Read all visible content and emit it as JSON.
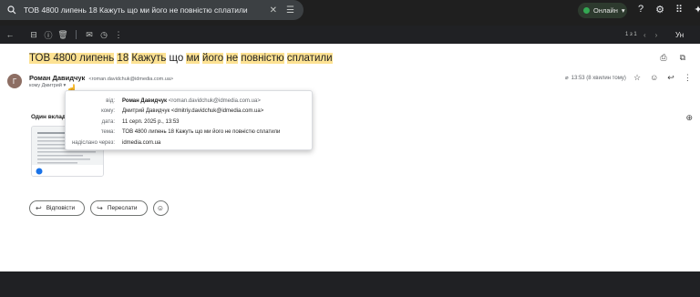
{
  "search": {
    "query": "ТОВ  4800 липень 18 Кажуть що ми його не повністю сплатили"
  },
  "status": {
    "label": "Онлайн"
  },
  "toolbar": {
    "count": "1 з 1",
    "lang": "Ун"
  },
  "email": {
    "subject_parts": [
      {
        "text": "ТОВ 4800 ",
        "hl": true
      },
      {
        "text": "липень",
        "hl": true
      },
      {
        "text": " ",
        "hl": false
      },
      {
        "text": "18",
        "hl": true
      },
      {
        "text": " ",
        "hl": false
      },
      {
        "text": "Кажуть",
        "hl": true
      },
      {
        "text": " що ",
        "hl": false
      },
      {
        "text": "ми",
        "hl": true
      },
      {
        "text": " ",
        "hl": false
      },
      {
        "text": "його",
        "hl": true
      },
      {
        "text": " ",
        "hl": false
      },
      {
        "text": "не",
        "hl": true
      },
      {
        "text": " ",
        "hl": false
      },
      {
        "text": "повністю",
        "hl": true
      },
      {
        "text": " ",
        "hl": false
      },
      {
        "text": "сплатили",
        "hl": true
      }
    ],
    "avatar_letter": "Г",
    "sender_name": "Роман Давидчук",
    "sender_email": "<roman.davidchuk@idmedia.com.ua>",
    "to_line": "кому Дмитрий",
    "time": "13:53 (8 хвилин тому)"
  },
  "popup": {
    "rows": [
      {
        "label": "від:",
        "name": "Роман Давидчук",
        "value": "<roman.davidchuk@idmedia.com.ua>"
      },
      {
        "label": "кому:",
        "name": "",
        "value": "Дмитрий Давидчук <dmitriy.davidchuk@idmedia.com.ua>"
      },
      {
        "label": "дата:",
        "name": "",
        "value": "11 серп. 2025 р., 13:53"
      },
      {
        "label": "тема:",
        "name": "",
        "value": "ТОВ 4800 липень 18 Кажуть що ми його не повністю сплатили"
      },
      {
        "label": "надіслано через:",
        "name": "",
        "value": "idmedia.com.ua"
      }
    ]
  },
  "attachments": {
    "header": "Один вкладений файл"
  },
  "actions": {
    "reply": "Відповісти",
    "forward": "Переслати"
  }
}
